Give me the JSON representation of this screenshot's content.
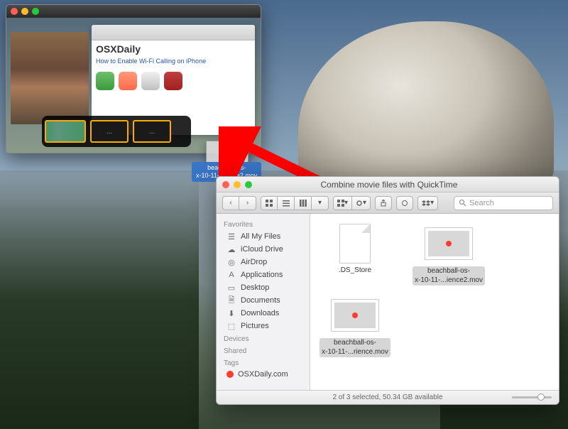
{
  "quicktime": {
    "browser_logo": "OSXDaily",
    "headline": "How to Enable Wi-Fi Calling on iPhone",
    "clip_placeholder": "..."
  },
  "drag": {
    "tooltip": "beachball-os-\nx-10-11-...ience2.mov"
  },
  "finder": {
    "title": "Combine movie files with QuickTime",
    "search_placeholder": "Search",
    "sidebar": {
      "favorites_header": "Favorites",
      "devices_header": "Devices",
      "shared_header": "Shared",
      "tags_header": "Tags",
      "items": {
        "all_my_files": "All My Files",
        "icloud": "iCloud Drive",
        "airdrop": "AirDrop",
        "applications": "Applications",
        "desktop": "Desktop",
        "documents": "Documents",
        "downloads": "Downloads",
        "pictures": "Pictures",
        "tag_osxdaily": "OSXDaily.com"
      }
    },
    "files": {
      "ds_store": ".DS_Store",
      "mov1": "beachball-os-\nx-10-11-...ience2.mov",
      "mov2": "beachball-os-\nx-10-11-...rience.mov"
    },
    "status": "2 of 3 selected, 50.34 GB available"
  }
}
